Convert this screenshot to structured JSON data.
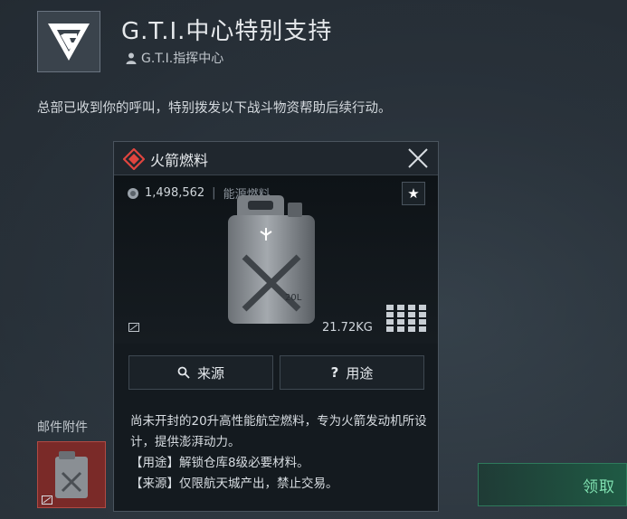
{
  "mail": {
    "title": "G.T.I.中心特别支持",
    "sender": "G.T.I.指挥中心",
    "message": "总部已收到你的呼叫，特别拨发以下战斗物资帮助后续行动。",
    "attachments_label": "邮件附件",
    "claim_label": "领取"
  },
  "item_popup": {
    "name": "火箭燃料",
    "price": "1,498,562",
    "category": "能源燃料",
    "weight": "21.72KG",
    "can_label": "20L",
    "source_label": "来源",
    "use_label": "用途",
    "description": "尚未开封的20升高性能航空燃料，专为火箭发动机所设计，提供澎湃动力。",
    "use_line": "【用途】解锁仓库8级必要材料。",
    "source_line": "【来源】仅限航天城产出，禁止交易。",
    "rarity_color": "#e0453f"
  },
  "colors": {
    "accent_green": "#7fe0b0",
    "rarity_red": "#e0453f"
  }
}
